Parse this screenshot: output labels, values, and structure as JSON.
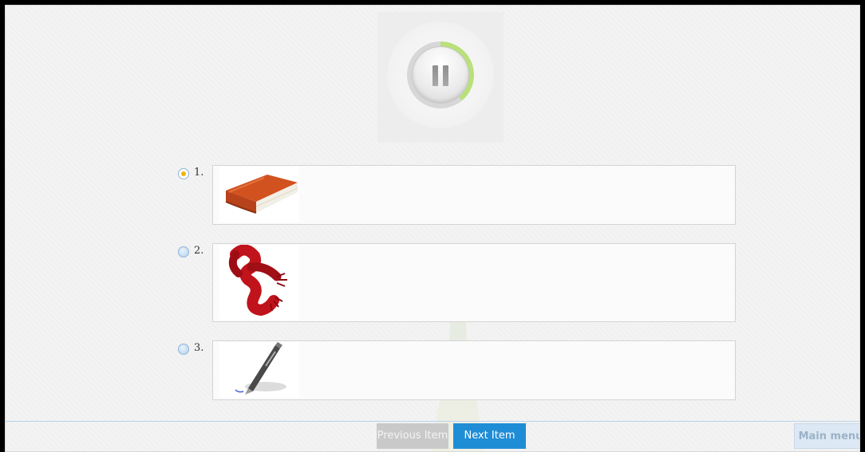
{
  "player": {
    "control_icon": "pause-icon",
    "progress_color": "#b9e07a"
  },
  "options": [
    {
      "number": "1.",
      "selected": true,
      "picture": "book"
    },
    {
      "number": "2.",
      "selected": false,
      "picture": "scarf"
    },
    {
      "number": "3.",
      "selected": false,
      "picture": "pen"
    }
  ],
  "footer": {
    "previous_label": "Previous Item",
    "next_label": "Next Item",
    "main_menu_label": "Main menu"
  },
  "colors": {
    "next_button": "#1f8dd6",
    "selected_radio": "#f0b400"
  }
}
